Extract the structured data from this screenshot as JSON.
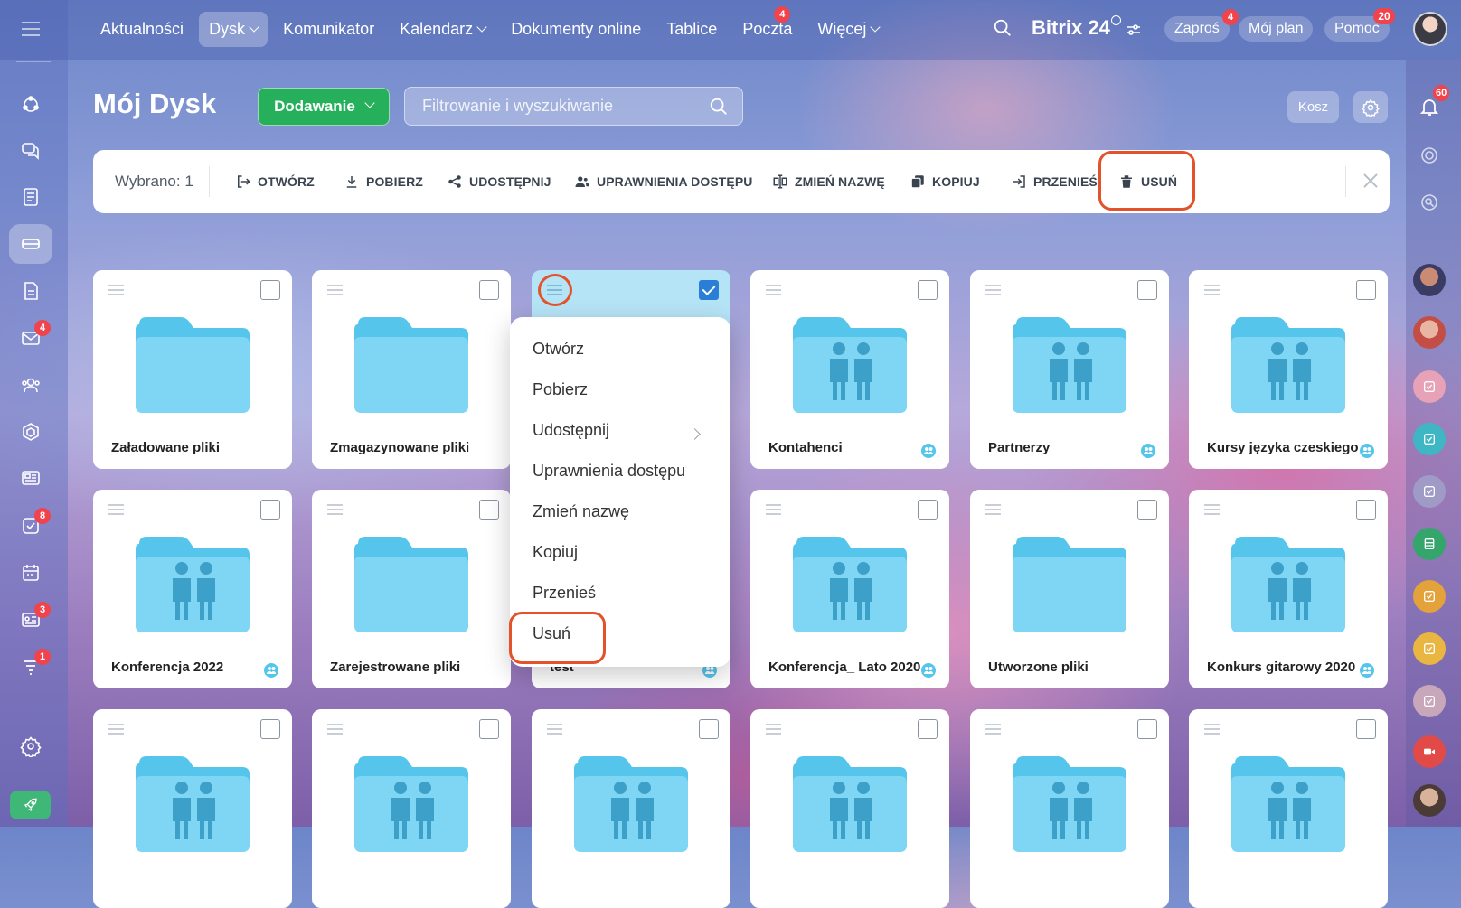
{
  "top_nav": {
    "items": [
      {
        "label": "Aktualności"
      },
      {
        "label": "Dysk",
        "dropdown": true,
        "active": true
      },
      {
        "label": "Komunikator"
      },
      {
        "label": "Kalendarz",
        "dropdown": true
      },
      {
        "label": "Dokumenty online"
      },
      {
        "label": "Tablice"
      },
      {
        "label": "Poczta",
        "badge": "4"
      },
      {
        "label": "Więcej",
        "dropdown": true
      }
    ],
    "logo": "Bitrix 24",
    "invite": {
      "label": "Zaproś",
      "badge": "4"
    },
    "my_plan": "Mój plan",
    "help": {
      "label": "Pomoc",
      "badge": "20"
    }
  },
  "left_sidebar": {
    "icons": [
      {
        "name": "activity-stream-icon"
      },
      {
        "name": "chat-icon"
      },
      {
        "name": "feed-icon"
      },
      {
        "name": "drive-icon",
        "active": true
      },
      {
        "name": "documents-icon"
      },
      {
        "name": "mail-icon",
        "badge": "4"
      },
      {
        "name": "contacts-icon"
      },
      {
        "name": "workgroups-icon"
      },
      {
        "name": "sites-icon"
      },
      {
        "name": "tasks-icon",
        "badge": "8"
      },
      {
        "name": "calendar-icon"
      },
      {
        "name": "news-icon",
        "badge": "3"
      },
      {
        "name": "filters-icon",
        "badge": "1"
      },
      {
        "name": "settings-icon"
      },
      {
        "name": "rocket-icon"
      }
    ]
  },
  "right_sidebar": {
    "notifications_badge": "60"
  },
  "page": {
    "title": "Mój Dysk",
    "add_button": "Dodawanie",
    "search_placeholder": "Filtrowanie i wyszukiwanie",
    "trash_button": "Kosz"
  },
  "toolbar": {
    "selected_text": "Wybrano: 1",
    "actions": [
      {
        "label": "OTWÓRZ",
        "icon": "open-icon"
      },
      {
        "label": "POBIERZ",
        "icon": "download-icon"
      },
      {
        "label": "UDOSTĘPNIJ",
        "icon": "share-icon"
      },
      {
        "label": "UPRAWNIENIA DOSTĘPU",
        "icon": "users-icon"
      },
      {
        "label": "ZMIEŃ NAZWĘ",
        "icon": "rename-icon"
      },
      {
        "label": "KOPIUJ",
        "icon": "copy-icon"
      },
      {
        "label": "PRZENIEŚ",
        "icon": "move-icon"
      },
      {
        "label": "USUŃ",
        "icon": "trash-icon",
        "highlighted": true
      }
    ]
  },
  "context_menu": {
    "items": [
      {
        "label": "Otwórz"
      },
      {
        "label": "Pobierz"
      },
      {
        "label": "Udostępnij",
        "submenu": true
      },
      {
        "label": "Uprawnienia dostępu"
      },
      {
        "label": "Zmień nazwę"
      },
      {
        "label": "Kopiuj"
      },
      {
        "label": "Przenieś"
      },
      {
        "label": "Usuń",
        "highlighted": true
      }
    ]
  },
  "folders": [
    {
      "name": "Załadowane pliki",
      "shared": false
    },
    {
      "name": "Zmagazynowane pliki",
      "shared": false
    },
    {
      "name": "",
      "shared": false,
      "selected": true
    },
    {
      "name": "Kontahenci",
      "shared": true
    },
    {
      "name": "Partnerzy",
      "shared": true
    },
    {
      "name": "Kursy języka czeskiego",
      "shared": true
    },
    {
      "name": "Konferencja 2022",
      "shared": true
    },
    {
      "name": "Zarejestrowane pliki",
      "shared": false
    },
    {
      "name": "test",
      "shared": true
    },
    {
      "name": "Konferencja_ Lato 2020",
      "shared": true
    },
    {
      "name": "Utworzone pliki",
      "shared": false
    },
    {
      "name": "Konkurs gitarowy 2020",
      "shared": true
    },
    {
      "name": "",
      "shared": true
    },
    {
      "name": "",
      "shared": true
    },
    {
      "name": "",
      "shared": true
    },
    {
      "name": "",
      "shared": true
    },
    {
      "name": "",
      "shared": true
    },
    {
      "name": "",
      "shared": true
    }
  ],
  "colors": {
    "accent_green": "#27b05b",
    "folder_blue": "#55c5ec",
    "highlight_red": "#e2522b",
    "badge_red": "#f0434b",
    "checkbox_blue": "#2a7ed6"
  }
}
